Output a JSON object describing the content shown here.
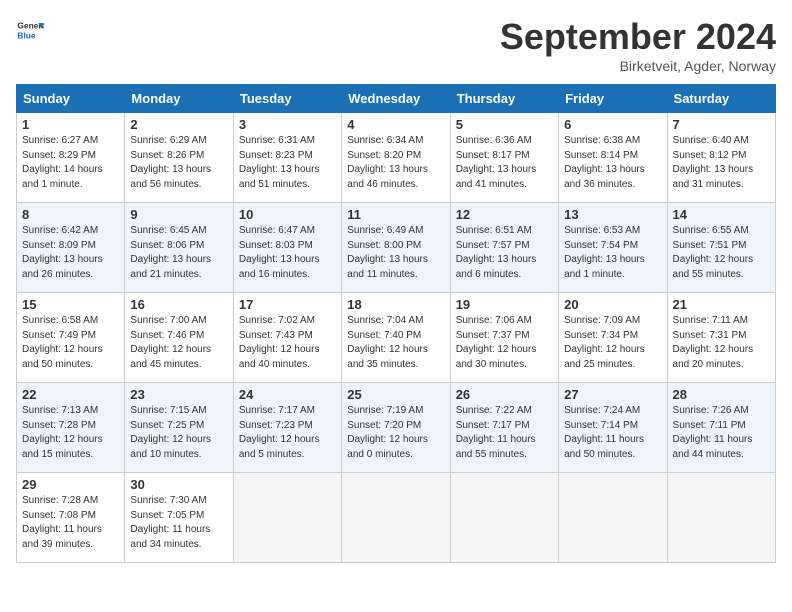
{
  "header": {
    "logo_line1": "General",
    "logo_line2": "Blue",
    "title": "September 2024",
    "subtitle": "Birketveit, Agder, Norway"
  },
  "days_of_week": [
    "Sunday",
    "Monday",
    "Tuesday",
    "Wednesday",
    "Thursday",
    "Friday",
    "Saturday"
  ],
  "weeks": [
    [
      {
        "day": 1,
        "sunrise": "6:27 AM",
        "sunset": "8:29 PM",
        "daylight": "14 hours and 1 minute."
      },
      {
        "day": 2,
        "sunrise": "6:29 AM",
        "sunset": "8:26 PM",
        "daylight": "13 hours and 56 minutes."
      },
      {
        "day": 3,
        "sunrise": "6:31 AM",
        "sunset": "8:23 PM",
        "daylight": "13 hours and 51 minutes."
      },
      {
        "day": 4,
        "sunrise": "6:34 AM",
        "sunset": "8:20 PM",
        "daylight": "13 hours and 46 minutes."
      },
      {
        "day": 5,
        "sunrise": "6:36 AM",
        "sunset": "8:17 PM",
        "daylight": "13 hours and 41 minutes."
      },
      {
        "day": 6,
        "sunrise": "6:38 AM",
        "sunset": "8:14 PM",
        "daylight": "13 hours and 36 minutes."
      },
      {
        "day": 7,
        "sunrise": "6:40 AM",
        "sunset": "8:12 PM",
        "daylight": "13 hours and 31 minutes."
      }
    ],
    [
      {
        "day": 8,
        "sunrise": "6:42 AM",
        "sunset": "8:09 PM",
        "daylight": "13 hours and 26 minutes."
      },
      {
        "day": 9,
        "sunrise": "6:45 AM",
        "sunset": "8:06 PM",
        "daylight": "13 hours and 21 minutes."
      },
      {
        "day": 10,
        "sunrise": "6:47 AM",
        "sunset": "8:03 PM",
        "daylight": "13 hours and 16 minutes."
      },
      {
        "day": 11,
        "sunrise": "6:49 AM",
        "sunset": "8:00 PM",
        "daylight": "13 hours and 11 minutes."
      },
      {
        "day": 12,
        "sunrise": "6:51 AM",
        "sunset": "7:57 PM",
        "daylight": "13 hours and 6 minutes."
      },
      {
        "day": 13,
        "sunrise": "6:53 AM",
        "sunset": "7:54 PM",
        "daylight": "13 hours and 1 minute."
      },
      {
        "day": 14,
        "sunrise": "6:55 AM",
        "sunset": "7:51 PM",
        "daylight": "12 hours and 55 minutes."
      }
    ],
    [
      {
        "day": 15,
        "sunrise": "6:58 AM",
        "sunset": "7:49 PM",
        "daylight": "12 hours and 50 minutes."
      },
      {
        "day": 16,
        "sunrise": "7:00 AM",
        "sunset": "7:46 PM",
        "daylight": "12 hours and 45 minutes."
      },
      {
        "day": 17,
        "sunrise": "7:02 AM",
        "sunset": "7:43 PM",
        "daylight": "12 hours and 40 minutes."
      },
      {
        "day": 18,
        "sunrise": "7:04 AM",
        "sunset": "7:40 PM",
        "daylight": "12 hours and 35 minutes."
      },
      {
        "day": 19,
        "sunrise": "7:06 AM",
        "sunset": "7:37 PM",
        "daylight": "12 hours and 30 minutes."
      },
      {
        "day": 20,
        "sunrise": "7:09 AM",
        "sunset": "7:34 PM",
        "daylight": "12 hours and 25 minutes."
      },
      {
        "day": 21,
        "sunrise": "7:11 AM",
        "sunset": "7:31 PM",
        "daylight": "12 hours and 20 minutes."
      }
    ],
    [
      {
        "day": 22,
        "sunrise": "7:13 AM",
        "sunset": "7:28 PM",
        "daylight": "12 hours and 15 minutes."
      },
      {
        "day": 23,
        "sunrise": "7:15 AM",
        "sunset": "7:25 PM",
        "daylight": "12 hours and 10 minutes."
      },
      {
        "day": 24,
        "sunrise": "7:17 AM",
        "sunset": "7:23 PM",
        "daylight": "12 hours and 5 minutes."
      },
      {
        "day": 25,
        "sunrise": "7:19 AM",
        "sunset": "7:20 PM",
        "daylight": "12 hours and 0 minutes."
      },
      {
        "day": 26,
        "sunrise": "7:22 AM",
        "sunset": "7:17 PM",
        "daylight": "11 hours and 55 minutes."
      },
      {
        "day": 27,
        "sunrise": "7:24 AM",
        "sunset": "7:14 PM",
        "daylight": "11 hours and 50 minutes."
      },
      {
        "day": 28,
        "sunrise": "7:26 AM",
        "sunset": "7:11 PM",
        "daylight": "11 hours and 44 minutes."
      }
    ],
    [
      {
        "day": 29,
        "sunrise": "7:28 AM",
        "sunset": "7:08 PM",
        "daylight": "11 hours and 39 minutes."
      },
      {
        "day": 30,
        "sunrise": "7:30 AM",
        "sunset": "7:05 PM",
        "daylight": "11 hours and 34 minutes."
      },
      null,
      null,
      null,
      null,
      null
    ]
  ]
}
